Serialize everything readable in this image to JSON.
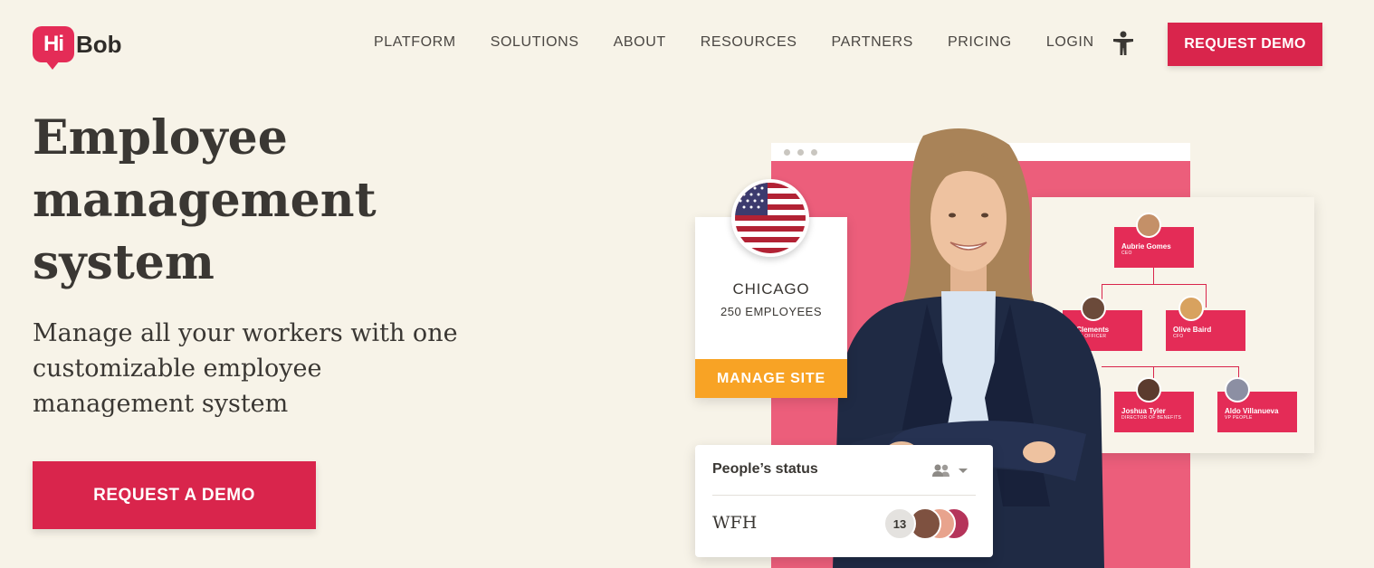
{
  "logo": {
    "hi": "Hi",
    "bob": "Bob"
  },
  "nav": {
    "items": [
      "PLATFORM",
      "SOLUTIONS",
      "ABOUT",
      "RESOURCES",
      "PARTNERS",
      "PRICING",
      "LOGIN"
    ],
    "accessibility_icon": "accessibility-icon",
    "cta": "REQUEST DEMO"
  },
  "hero": {
    "title": "Employee management system",
    "subtitle": "Manage all your workers with one customizable employee management system",
    "cta": "REQUEST A DEMO"
  },
  "site_card": {
    "city": "CHICAGO",
    "employees": "250 EMPLOYEES",
    "button": "MANAGE SITE",
    "flag_icon": "us-flag-icon"
  },
  "org_chart": {
    "ceo": {
      "name": "Aubrie Gomes",
      "role": "CEO"
    },
    "level2": [
      {
        "name": "n Clements",
        "role": "OPLE OFFICER"
      },
      {
        "name": "Olive Baird",
        "role": "CFO"
      }
    ],
    "level3": [
      {
        "name": "Joshua Tyler",
        "role": "DIRECTOR OF BENEFITS"
      },
      {
        "name": "Aldo Villanueva",
        "role": "VP PEOPLE"
      }
    ]
  },
  "status": {
    "title": "People’s status",
    "label": "WFH",
    "count": "13",
    "filter_icon": "people-icon"
  },
  "colors": {
    "brand": "#d9254c",
    "panel": "#ec5e7b",
    "orange": "#f8a325",
    "background": "#f7f3e8"
  }
}
